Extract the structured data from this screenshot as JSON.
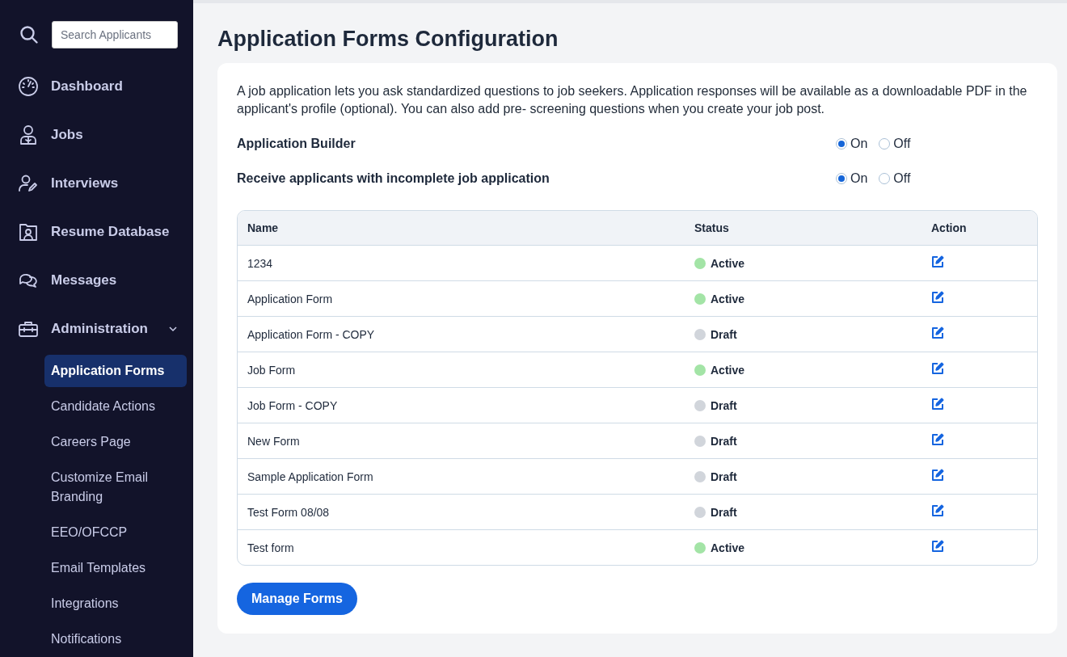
{
  "sidebar": {
    "search": {
      "placeholder": "Search Applicants"
    },
    "items": [
      {
        "kind": "dashboard",
        "label": "Dashboard"
      },
      {
        "kind": "jobs",
        "label": "Jobs"
      },
      {
        "kind": "interviews",
        "label": "Interviews"
      },
      {
        "kind": "resume",
        "label": "Resume Database"
      },
      {
        "kind": "messages",
        "label": "Messages"
      },
      {
        "kind": "administration",
        "label": "Administration",
        "expanded": true,
        "children": [
          {
            "label": "Application Forms",
            "selected": true
          },
          {
            "label": "Candidate Actions",
            "selected": false
          },
          {
            "label": "Careers Page",
            "selected": false
          },
          {
            "label": "Customize Email Branding",
            "selected": false
          },
          {
            "label": "EEO/OFCCP",
            "selected": false
          },
          {
            "label": "Email Templates",
            "selected": false
          },
          {
            "label": "Integrations",
            "selected": false
          },
          {
            "label": "Notifications",
            "selected": false
          }
        ]
      }
    ]
  },
  "page": {
    "title": "Application Forms Configuration",
    "description": "A job application lets you ask standardized questions to job seekers. Application responses will be available as a downloadable PDF in the applicant's profile (optional). You can also add pre- screening questions when you create your job post.",
    "settings": [
      {
        "label": "Application Builder",
        "options": [
          {
            "label": "On",
            "selected": true
          },
          {
            "label": "Off",
            "selected": false
          }
        ]
      },
      {
        "label": "Receive applicants with incomplete job application",
        "options": [
          {
            "label": "On",
            "selected": true
          },
          {
            "label": "Off",
            "selected": false
          }
        ]
      }
    ],
    "table": {
      "columns": [
        "Name",
        "Status",
        "Action"
      ],
      "rows": [
        {
          "name": "1234",
          "status": "Active",
          "color": "#a3e4a6"
        },
        {
          "name": "Application Form",
          "status": "Active",
          "color": "#a3e4a6"
        },
        {
          "name": "Application Form - COPY",
          "status": "Draft",
          "color": "#d1d5db"
        },
        {
          "name": "Job Form",
          "status": "Active",
          "color": "#a3e4a6"
        },
        {
          "name": "Job Form - COPY",
          "status": "Draft",
          "color": "#d1d5db"
        },
        {
          "name": "New Form",
          "status": "Draft",
          "color": "#d1d5db"
        },
        {
          "name": "Sample Application Form",
          "status": "Draft",
          "color": "#d1d5db"
        },
        {
          "name": "Test Form 08/08",
          "status": "Draft",
          "color": "#d1d5db"
        },
        {
          "name": "Test form",
          "status": "Active",
          "color": "#a3e4a6"
        }
      ]
    },
    "button": "Manage Forms"
  }
}
